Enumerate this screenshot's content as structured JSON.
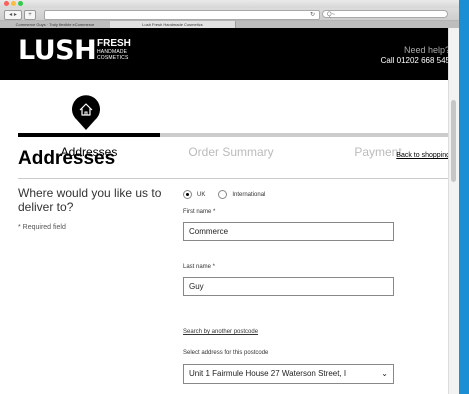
{
  "browser": {
    "tabs": [
      {
        "label": "Commerce Guys · Truly flexible eCommerce"
      },
      {
        "label": "Lush Fresh Handmade Cosmetics"
      }
    ],
    "search_placeholder": "Q~"
  },
  "header": {
    "logo": "LUSH",
    "tagline": [
      "FRESH",
      "HANDMADE",
      "COSMETICS"
    ],
    "help_text": "Need help?",
    "phone": "Call 01202 668 545"
  },
  "checkout": {
    "steps": [
      "Addresses",
      "Order Summary",
      "Payment"
    ],
    "active_step": 0,
    "progress": 0.33
  },
  "form": {
    "title": "Addresses",
    "back_link": "Back to shopping",
    "question": "Where would you like us to deliver to?",
    "required_note": "* Required field",
    "radio_uk": "UK",
    "radio_international": "International",
    "first_name_label": "First name *",
    "first_name_value": "Commerce",
    "last_name_label": "Last name *",
    "last_name_value": "Guy",
    "postcode_link": "Search by another postcode",
    "address_select_label": "Select address for this postcode",
    "address_select_value": "Unit 1 Fairmule House 27 Waterson Street, I"
  },
  "colors": {
    "header_bg": "#000000",
    "accent": "#000000",
    "desktop_bg": "#1a8fd6"
  }
}
